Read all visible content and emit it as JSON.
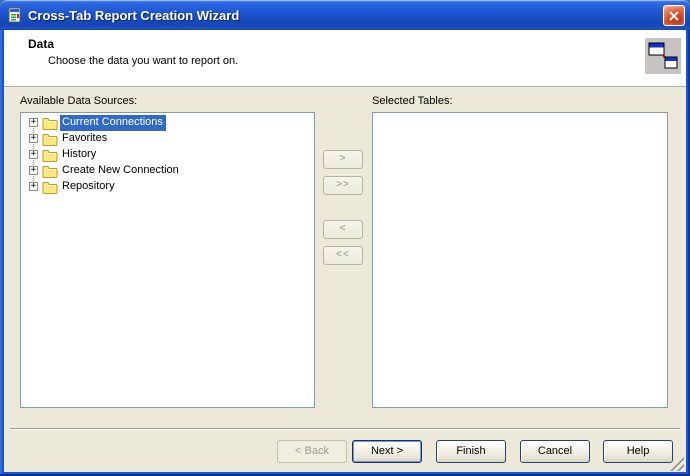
{
  "window": {
    "title": "Cross-Tab Report Creation Wizard"
  },
  "header": {
    "title": "Data",
    "subtitle": "Choose the data you want to report on."
  },
  "available": {
    "label": "Available Data Sources:"
  },
  "selected": {
    "label": "Selected Tables:",
    "items": []
  },
  "tree": {
    "items": [
      {
        "label": "Current Connections",
        "selected": true,
        "expandable": true
      },
      {
        "label": "Favorites",
        "selected": false,
        "expandable": true
      },
      {
        "label": "History",
        "selected": false,
        "expandable": true
      },
      {
        "label": "Create New Connection",
        "selected": false,
        "expandable": true
      },
      {
        "label": "Repository",
        "selected": false,
        "expandable": true
      }
    ]
  },
  "transfer": {
    "add": ">",
    "add_all": ">>",
    "remove": "<",
    "remove_all": "<<",
    "enabled": false
  },
  "footer": {
    "back": "< Back",
    "next": "Next >",
    "finish": "Finish",
    "cancel": "Cancel",
    "help": "Help",
    "back_enabled": false,
    "default_button": "next"
  },
  "icons": {
    "expander": "+"
  },
  "colors": {
    "titlebar_blue": "#1d55d2",
    "content_bg": "#ece9d8",
    "selection_blue": "#316ac5",
    "box_border": "#7f9db9",
    "close_red": "#cc3a12"
  }
}
